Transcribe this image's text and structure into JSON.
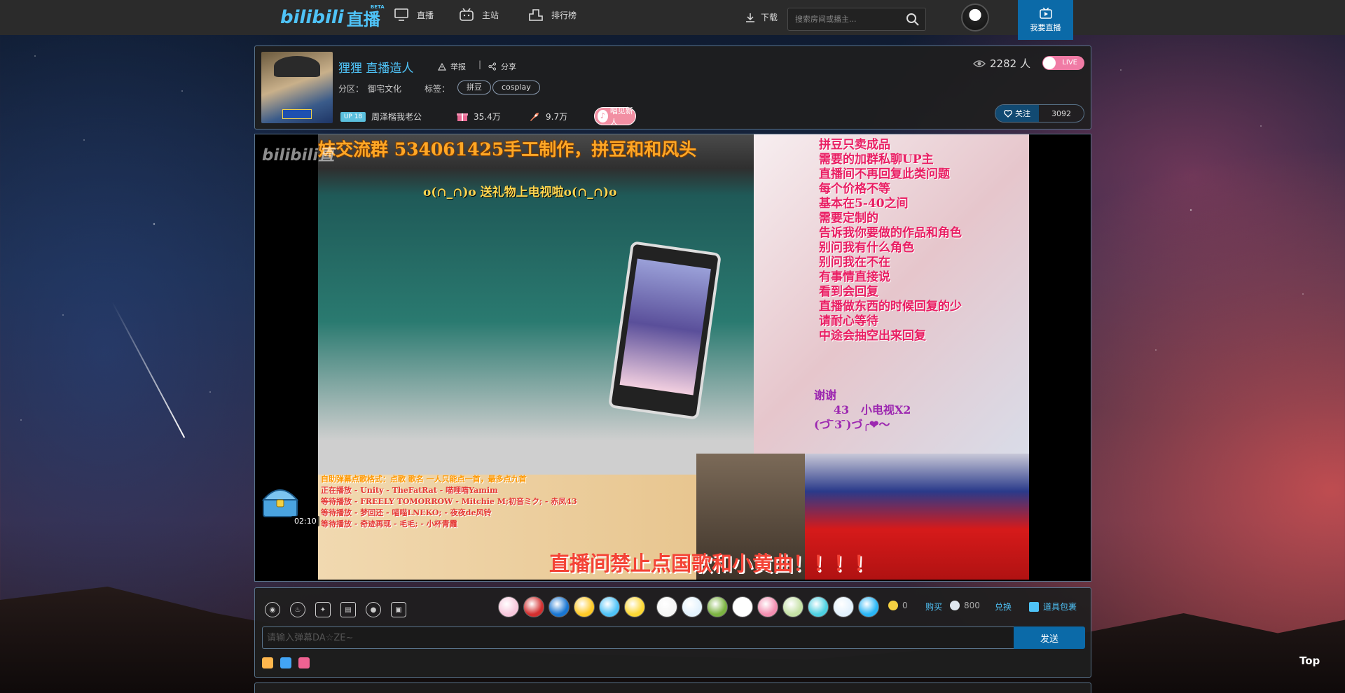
{
  "nav": {
    "logo": "bilibili",
    "logo_suffix": "直播",
    "beta": "BETA",
    "items": [
      {
        "label": "直播",
        "icon": "monitor-icon"
      },
      {
        "label": "主站",
        "icon": "tv-icon"
      },
      {
        "label": "排行榜",
        "icon": "ranking-icon"
      }
    ],
    "download": "下载",
    "search_placeholder": "搜索房间或播主...",
    "go_live": "我要直播"
  },
  "room": {
    "title": "狸狸 直播造人",
    "report": "举报",
    "separator": "|",
    "share": "分享",
    "area_label": "分区：",
    "area_value": "御宅文化",
    "tags_label": "标签：",
    "tags": [
      "拼豆",
      "cosplay"
    ],
    "viewers": "2282 人",
    "live_badge": "LIVE",
    "level_badge": "UP 18",
    "anchor_name": "周泽楷我老公",
    "gifts_count": "35.4万",
    "rockets_count": "9.7万",
    "sing_label": "唱见新人",
    "follow_label": "关注",
    "follow_count": "3092"
  },
  "video": {
    "watermark": "bilibili直",
    "banner": "妹交流群 534061425手工制作，拼豆和和风头",
    "gift_line": "o(∩_∩)o 送礼物上电视啦o(∩_∩)o",
    "rules": "拼豆只卖成品\n需要的加群私聊UP主\n直播间不再回复此类问题\n每个价格不等\n基本在5-40之间\n需要定制的\n告诉我你要做的作品和角色\n别问我有什么角色\n别问我在不在\n有事情直接说\n看到会回复\n直播做东西的时候回复的少\n请耐心等待\n中途会抽空出来回复",
    "thanks": "谢谢\n     43   小电视X2\n(づ ̄3 ̄)づ╭❤～",
    "queue_header": "自助弹幕点歌格式：点歌 歌名 一人只能点一首，最多点九首",
    "queue": "正在播放 - Unity - TheFatRat - 喵哩喵Yamim\n等待播放 - FREELY TOMORROW - Mitchie M;初音ミク; - 赤凤43\n等待播放 - 梦回还 - 喵喵LNEKO; - 夜夜de风铃\n等待播放 - 奇迹再现 - 毛毛; - 小杯青霞",
    "ban_text": "直播间禁止点国歌和小黄曲！！！！",
    "timer": "02:10"
  },
  "controls": {
    "seed_gold": "0",
    "buy": "购买",
    "seed_silver": "800",
    "exchange": "兑换",
    "bag": "道具包裹",
    "chat_placeholder": "请输入弹幕DA☆ZE~",
    "send": "发送",
    "gift_colors": [
      "#f8c8dc",
      "#d32f2f",
      "#1976d2",
      "#ffca28",
      "#4fc3f7",
      "#fdd835",
      "#f5f5f5",
      "#e3f2fd",
      "#7cb342",
      "#ffffff",
      "#f48fb1",
      "#c5e1a5",
      "#4dd0e1",
      "#e3f2fd",
      "#29b6f6"
    ],
    "mini_colors": [
      "#ffb74d",
      "#42a5f5",
      "#f06292"
    ]
  },
  "footer": {
    "top": "Top"
  }
}
